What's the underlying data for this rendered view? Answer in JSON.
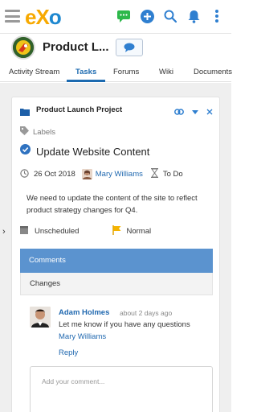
{
  "app": {
    "logo_text_e": "e",
    "logo_text_x": "X",
    "logo_text_o": "o",
    "icons": [
      "menu-icon",
      "chat-icon",
      "add-icon",
      "search-icon",
      "bell-icon",
      "more-icon"
    ]
  },
  "space": {
    "title": "Product L...",
    "chat_icon": "chat-bubble-icon"
  },
  "tabs": [
    {
      "label": "Activity Stream",
      "active": false
    },
    {
      "label": "Tasks",
      "active": true
    },
    {
      "label": "Forums",
      "active": false
    },
    {
      "label": "Wiki",
      "active": false
    },
    {
      "label": "Documents",
      "active": false
    }
  ],
  "task": {
    "project": "Product Launch Project",
    "labels_placeholder": "Labels",
    "title": "Update Website Content",
    "due_date": "26 Oct 2018",
    "assignee": "Mary Williams",
    "status": "To Do",
    "description": "We need to update the content of the site to reflect product strategy changes for Q4.",
    "schedule": "Unscheduled",
    "priority": "Normal"
  },
  "activity_tabs": {
    "comments": "Comments",
    "changes": "Changes"
  },
  "comment": {
    "author": "Adam Holmes",
    "time": "about 2 days ago",
    "text": "Let me know if you have any questions",
    "mention": "Mary Williams",
    "reply_label": "Reply"
  },
  "comment_input": {
    "placeholder": "Add your comment..."
  },
  "colors": {
    "accent": "#1c6ab0",
    "logo_orange": "#f7a900",
    "logo_blue": "#1e88d0",
    "chat_green": "#2db84b",
    "comments_tab": "#5b93cf",
    "priority_flag": "#f5b400"
  }
}
